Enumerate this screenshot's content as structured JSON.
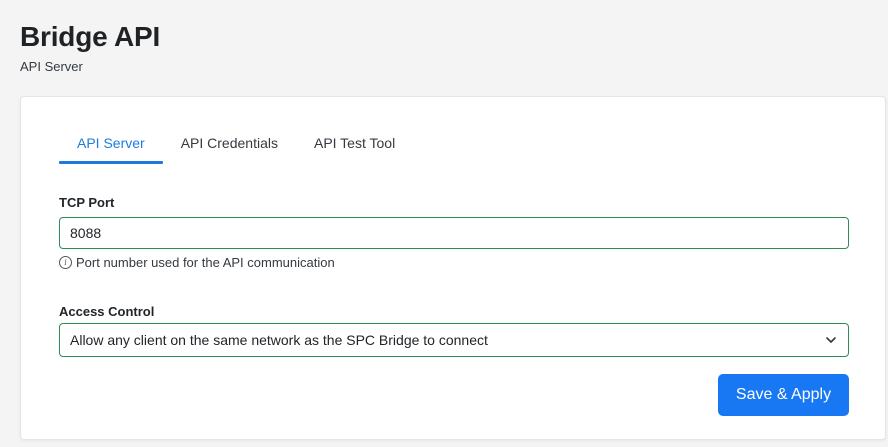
{
  "header": {
    "title": "Bridge API",
    "subtitle": "API Server"
  },
  "tabs": [
    {
      "label": "API Server",
      "active": true
    },
    {
      "label": "API Credentials",
      "active": false
    },
    {
      "label": "API Test Tool",
      "active": false
    }
  ],
  "tcp_port": {
    "label": "TCP Port",
    "value": "8088",
    "help_icon": "info-icon",
    "help": "Port number used for the API communication"
  },
  "access_control": {
    "label": "Access Control",
    "selected": "Allow any client on the same network as the SPC Bridge to connect",
    "icon": "chevron-down-icon"
  },
  "actions": {
    "save_label": "Save & Apply"
  },
  "colors": {
    "accent": "#1f7ae0",
    "button": "#1877f2",
    "field_border": "#2e8b57",
    "background": "#f4f4f5"
  }
}
